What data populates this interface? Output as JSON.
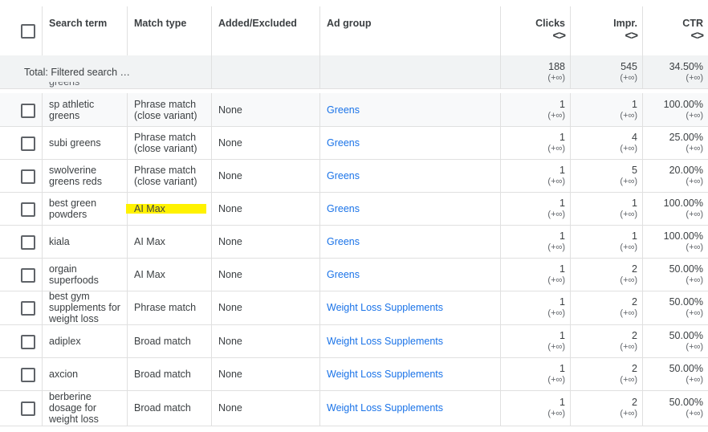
{
  "header": {
    "search_term": "Search term",
    "match_type": "Match type",
    "added_excluded": "Added/Excluded",
    "ad_group": "Ad group",
    "clicks": "Clicks",
    "impr": "Impr.",
    "ctr": "CTR",
    "sort_glyph": "<>"
  },
  "total": {
    "label": "Total: Filtered search te…",
    "clicks": "188",
    "clicks_sub": "(+∞)",
    "impr": "545",
    "impr_sub": "(+∞)",
    "ctr": "34.50%",
    "ctr_sub": "(+∞)"
  },
  "partial_row_text": "greens",
  "rows": [
    {
      "term": "sp athletic greens",
      "match": "Phrase match (close variant)",
      "added": "None",
      "adgroup": "Greens",
      "clicks": "1",
      "clicks_sub": "(+∞)",
      "impr": "1",
      "impr_sub": "(+∞)",
      "ctr": "100.00%",
      "ctr_sub": "(+∞)",
      "highlight": false
    },
    {
      "term": "subi greens",
      "match": "Phrase match (close variant)",
      "added": "None",
      "adgroup": "Greens",
      "clicks": "1",
      "clicks_sub": "(+∞)",
      "impr": "4",
      "impr_sub": "(+∞)",
      "ctr": "25.00%",
      "ctr_sub": "(+∞)",
      "highlight": false
    },
    {
      "term": "swolverine greens reds",
      "match": "Phrase match (close variant)",
      "added": "None",
      "adgroup": "Greens",
      "clicks": "1",
      "clicks_sub": "(+∞)",
      "impr": "5",
      "impr_sub": "(+∞)",
      "ctr": "20.00%",
      "ctr_sub": "(+∞)",
      "highlight": false
    },
    {
      "term": "best green powders",
      "match": "AI Max",
      "added": "None",
      "adgroup": "Greens",
      "clicks": "1",
      "clicks_sub": "(+∞)",
      "impr": "1",
      "impr_sub": "(+∞)",
      "ctr": "100.00%",
      "ctr_sub": "(+∞)",
      "highlight": true
    },
    {
      "term": "kiala",
      "match": "AI Max",
      "added": "None",
      "adgroup": "Greens",
      "clicks": "1",
      "clicks_sub": "(+∞)",
      "impr": "1",
      "impr_sub": "(+∞)",
      "ctr": "100.00%",
      "ctr_sub": "(+∞)",
      "highlight": false
    },
    {
      "term": "orgain superfoods",
      "match": "AI Max",
      "added": "None",
      "adgroup": "Greens",
      "clicks": "1",
      "clicks_sub": "(+∞)",
      "impr": "2",
      "impr_sub": "(+∞)",
      "ctr": "50.00%",
      "ctr_sub": "(+∞)",
      "highlight": false
    },
    {
      "term": "best gym supplements for weight loss",
      "match": "Phrase match",
      "added": "None",
      "adgroup": "Weight Loss Supplements",
      "clicks": "1",
      "clicks_sub": "(+∞)",
      "impr": "2",
      "impr_sub": "(+∞)",
      "ctr": "50.00%",
      "ctr_sub": "(+∞)",
      "highlight": false
    },
    {
      "term": "adiplex",
      "match": "Broad match",
      "added": "None",
      "adgroup": "Weight Loss Supplements",
      "clicks": "1",
      "clicks_sub": "(+∞)",
      "impr": "2",
      "impr_sub": "(+∞)",
      "ctr": "50.00%",
      "ctr_sub": "(+∞)",
      "highlight": false
    },
    {
      "term": "axcion",
      "match": "Broad match",
      "added": "None",
      "adgroup": "Weight Loss Supplements",
      "clicks": "1",
      "clicks_sub": "(+∞)",
      "impr": "2",
      "impr_sub": "(+∞)",
      "ctr": "50.00%",
      "ctr_sub": "(+∞)",
      "highlight": false
    },
    {
      "term": "berberine dosage for weight loss",
      "match": "Broad match",
      "added": "None",
      "adgroup": "Weight Loss Supplements",
      "clicks": "1",
      "clicks_sub": "(+∞)",
      "impr": "2",
      "impr_sub": "(+∞)",
      "ctr": "50.00%",
      "ctr_sub": "(+∞)",
      "highlight": false
    }
  ],
  "colors": {
    "link": "#1a73e8",
    "highlight": "#fff200",
    "total_bg": "#f1f3f4",
    "border": "#e0e0e0"
  }
}
